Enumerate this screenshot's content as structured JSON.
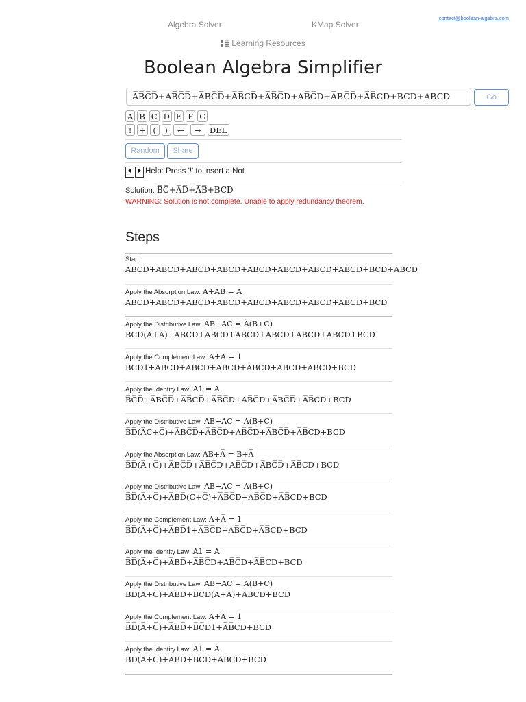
{
  "nav": {
    "algebra_solver": "Algebra Solver",
    "kmap_solver": "KMap Solver",
    "contact": "contact@boolean-algebra.com",
    "learning_resources": "Learning Resources"
  },
  "title": "Boolean Algebra Simplifier",
  "input": {
    "expression_text": "A̅B̅C̅D̅+AB̅C̅D̅+A̅BC̅D̅+A̅B̅CD̅+A̅B̅C̅D+AB̅C̅D+A̅BC̅D̅+A̅B̅CD+BCD+ABCD",
    "go_label": "Go"
  },
  "keyboard": {
    "row1": [
      "A",
      "B",
      "C",
      "D",
      "E",
      "F",
      "G"
    ],
    "row2": [
      "!",
      "+",
      "(",
      ")",
      "←",
      "→",
      "DEL"
    ]
  },
  "buttons": {
    "random": "Random",
    "share": "Share"
  },
  "help_text": "Help: Press '!' to insert a Not",
  "solution": {
    "label": "Solution:",
    "expression_text": "B̅C̅+A̅D̅+A̅B̅+BCD",
    "warning": "WARNING: Solution is not complete. Unable to apply redundancy theorem."
  },
  "steps_heading": "Steps",
  "steps": [
    {
      "label": "Start",
      "law": "",
      "expr": "A̅B̅C̅D̅+AB̅C̅D̅+A̅BC̅D̅+A̅B̅CD̅+A̅B̅C̅D+AB̅C̅D+A̅BC̅D̅+A̅B̅CD+BCD+ABCD"
    },
    {
      "label": "Apply the Absorption Law:",
      "law": "A+AB = A",
      "expr": "A̅B̅C̅D̅+AB̅C̅D̅+A̅BC̅D̅+A̅B̅CD̅+A̅B̅C̅D+AB̅C̅D+A̅BC̅D̅+A̅B̅CD+BCD"
    },
    {
      "label": "Apply the Distributive Law:",
      "law": "AB+AC = A(B+C)",
      "expr": "B̅C̅D̅(A̅+A)+A̅BC̅D̅+A̅B̅CD̅+A̅B̅C̅D+AB̅C̅D+A̅BC̅D̅+A̅B̅CD+BCD"
    },
    {
      "label": "Apply the Complement Law:",
      "law": "A+A̅ = 1",
      "expr": "B̅C̅D̅1+A̅BC̅D̅+A̅B̅CD̅+A̅B̅C̅D+AB̅C̅D+A̅BC̅D̅+A̅B̅CD+BCD"
    },
    {
      "label": "Apply the Identity Law:",
      "law": "A1 = A",
      "expr": "B̅C̅D̅+A̅BC̅D̅+A̅B̅CD̅+A̅B̅C̅D+AB̅C̅D+A̅BC̅D̅+A̅B̅CD+BCD"
    },
    {
      "label": "Apply the Distributive Law:",
      "law": "AB+AC = A(B+C)",
      "expr": "B̅D̅(A̅C+C̅)+A̅BC̅D̅+A̅B̅C̅D+AB̅C̅D+A̅BC̅D̅+A̅B̅CD+BCD"
    },
    {
      "label": "Apply the Absorption Law:",
      "law": "AB+A̅ = B+A̅",
      "expr": "B̅D̅(A̅+C̅)+A̅BC̅D̅+A̅B̅C̅D+AB̅C̅D+A̅BC̅D̅+A̅B̅CD+BCD"
    },
    {
      "label": "Apply the Distributive Law:",
      "law": "AB+AC = A(B+C)",
      "expr": "B̅D̅(A̅+C̅)+A̅BD̅(C+C̅)+A̅B̅C̅D+AB̅C̅D+A̅B̅CD+BCD"
    },
    {
      "label": "Apply the Complement Law:",
      "law": "A+A̅ = 1",
      "expr": "B̅D̅(A̅+C̅)+A̅BD̅1+A̅B̅C̅D+AB̅C̅D+A̅B̅CD+BCD"
    },
    {
      "label": "Apply the Identity Law:",
      "law": "A1 = A",
      "expr": "B̅D̅(A̅+C̅)+A̅BD̅+A̅B̅C̅D+AB̅C̅D+A̅B̅CD+BCD"
    },
    {
      "label": "Apply the Distributive Law:",
      "law": "AB+AC = A(B+C)",
      "expr": "B̅D̅(A̅+C̅)+A̅BD̅+B̅C̅D(A̅+A)+A̅B̅CD+BCD"
    },
    {
      "label": "Apply the Complement Law:",
      "law": "A+A̅ = 1",
      "expr": "B̅D̅(A̅+C̅)+A̅BD̅+B̅C̅D1+A̅B̅CD+BCD"
    },
    {
      "label": "Apply the Identity Law:",
      "law": "A1 = A",
      "expr": "B̅D̅(A̅+C̅)+A̅BD̅+B̅C̅D+A̅B̅CD+BCD"
    }
  ]
}
